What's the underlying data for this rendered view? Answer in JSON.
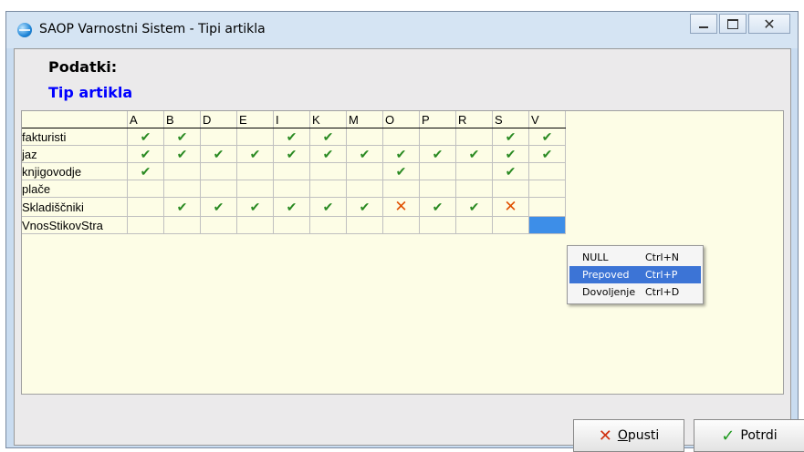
{
  "window": {
    "title": "SAOP Varnostni Sistem - Tipi artikla",
    "controls": [
      "minimize-icon",
      "maximize-icon",
      "close-icon"
    ]
  },
  "header": {
    "section_label": "Podatki:",
    "subtitle": "Tip artikla"
  },
  "grid": {
    "columns": [
      "A",
      "B",
      "D",
      "E",
      "I",
      "K",
      "M",
      "O",
      "P",
      "R",
      "S",
      "V"
    ],
    "rows": [
      {
        "name": "fakturisti",
        "cells": [
          "allow",
          "allow",
          "",
          "",
          "allow",
          "allow",
          "",
          "",
          "",
          "",
          "allow",
          "allow"
        ]
      },
      {
        "name": "jaz",
        "cells": [
          "allow",
          "allow",
          "allow",
          "allow",
          "allow",
          "allow",
          "allow",
          "allow",
          "allow",
          "allow",
          "allow",
          "allow"
        ]
      },
      {
        "name": "knjigovodje",
        "cells": [
          "allow",
          "",
          "",
          "",
          "",
          "",
          "",
          "allow",
          "",
          "",
          "allow",
          ""
        ]
      },
      {
        "name": "plače",
        "cells": [
          "",
          "",
          "",
          "",
          "",
          "",
          "",
          "",
          "",
          "",
          "",
          ""
        ]
      },
      {
        "name": "Skladiščniki",
        "cells": [
          "",
          "allow",
          "allow",
          "allow",
          "allow",
          "allow",
          "allow",
          "deny",
          "allow",
          "allow",
          "deny",
          ""
        ]
      },
      {
        "name": "VnosStikovStra",
        "cells": [
          "",
          "",
          "",
          "",
          "",
          "",
          "",
          "",
          "",
          "",
          "",
          "selected"
        ]
      }
    ],
    "symbols": {
      "allow": "✔",
      "deny": "✕"
    },
    "colors": {
      "allow": "#2a8a22",
      "deny": "#e05000",
      "selected": "#3d8ee8",
      "background": "#fdfde6"
    }
  },
  "context_menu": {
    "items": [
      {
        "label": "NULL",
        "shortcut": "Ctrl+N"
      },
      {
        "label": "Prepoved",
        "shortcut": "Ctrl+P",
        "active": true
      },
      {
        "label": "Dovoljenje",
        "shortcut": "Ctrl+D"
      }
    ]
  },
  "buttons": {
    "cancel_label": "Opusti",
    "cancel_icon": "x-icon",
    "ok_label": "Potrdi",
    "ok_icon": "checkmark-icon"
  }
}
